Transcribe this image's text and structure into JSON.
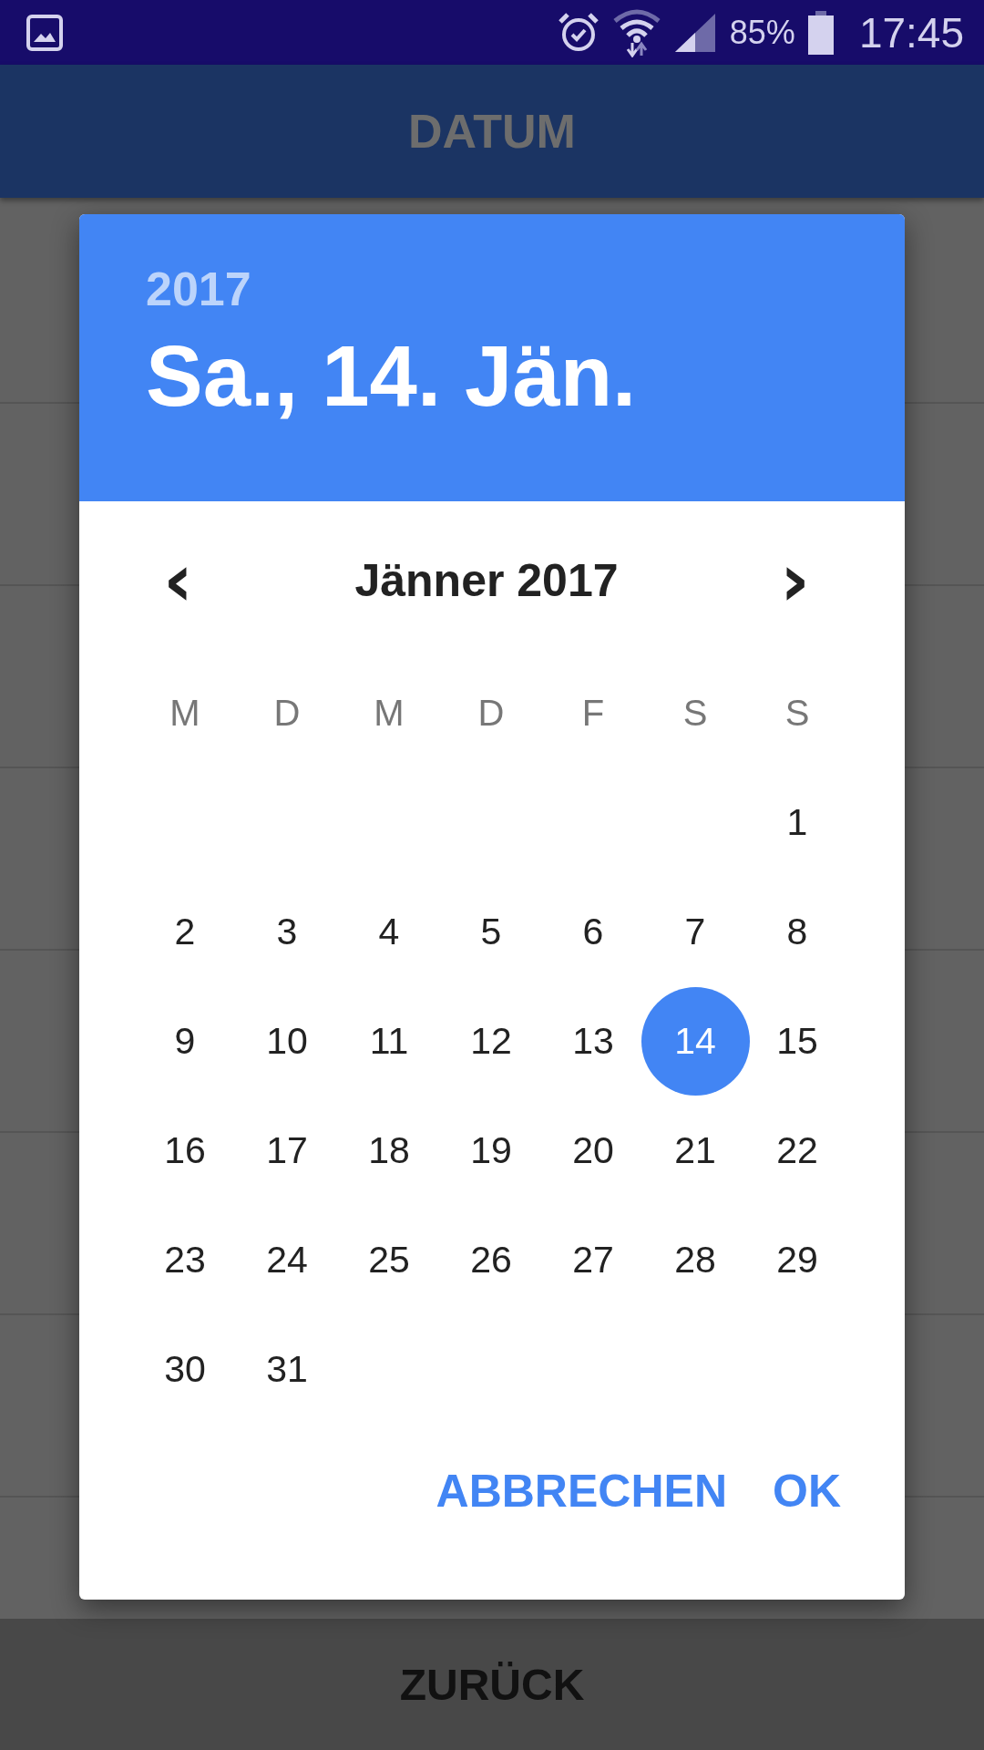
{
  "status_bar": {
    "battery": "85%",
    "time": "17:45"
  },
  "app_bar": {
    "title": "DATUM"
  },
  "dialog": {
    "year": "2017",
    "date": "Sa., 14. Jän.",
    "month": "Jänner 2017",
    "prev": "‹",
    "next": "›",
    "weekdays": [
      "M",
      "D",
      "M",
      "D",
      "F",
      "S",
      "S"
    ],
    "weeks": [
      {
        "days": [
          {
            "label": "1",
            "selected": false
          }
        ]
      },
      {
        "days": [
          {
            "label": "2",
            "selected": false
          },
          {
            "label": "3",
            "selected": false
          },
          {
            "label": "4",
            "selected": false
          },
          {
            "label": "5",
            "selected": false
          },
          {
            "label": "6",
            "selected": false
          },
          {
            "label": "7",
            "selected": false
          },
          {
            "label": "8",
            "selected": false
          }
        ]
      },
      {
        "days": [
          {
            "label": "9",
            "selected": false
          },
          {
            "label": "10",
            "selected": false
          },
          {
            "label": "11",
            "selected": false
          },
          {
            "label": "12",
            "selected": false
          },
          {
            "label": "13",
            "selected": false
          },
          {
            "label": "14",
            "selected": true
          },
          {
            "label": "15",
            "selected": false
          }
        ]
      },
      {
        "days": [
          {
            "label": "16",
            "selected": false
          },
          {
            "label": "17",
            "selected": false
          },
          {
            "label": "18",
            "selected": false
          },
          {
            "label": "19",
            "selected": false
          },
          {
            "label": "20",
            "selected": false
          },
          {
            "label": "21",
            "selected": false
          },
          {
            "label": "22",
            "selected": false
          }
        ]
      },
      {
        "days": [
          {
            "label": "23",
            "selected": false
          },
          {
            "label": "24",
            "selected": false
          },
          {
            "label": "25",
            "selected": false
          },
          {
            "label": "26",
            "selected": false
          },
          {
            "label": "27",
            "selected": false
          },
          {
            "label": "28",
            "selected": false
          },
          {
            "label": "29",
            "selected": false
          }
        ]
      },
      {
        "days": [
          {
            "label": "30",
            "selected": false
          },
          {
            "label": "31",
            "selected": false
          }
        ]
      }
    ],
    "buttons": [
      "ABBRECHEN",
      "OK"
    ]
  },
  "bottom_bar": {
    "button": "ZURÜCK"
  }
}
